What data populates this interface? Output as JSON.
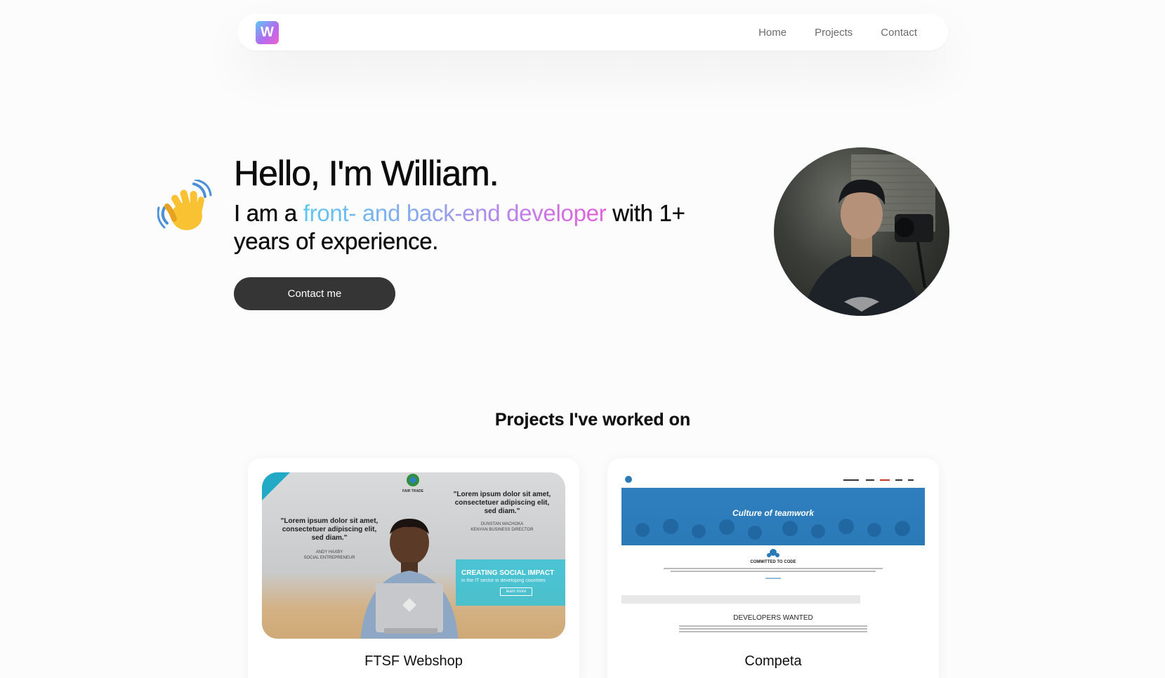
{
  "nav": {
    "logo_letter": "W",
    "links": [
      "Home",
      "Projects",
      "Contact"
    ]
  },
  "hero": {
    "title": "Hello, I'm William.",
    "sub_prefix": "I am a ",
    "sub_highlight": "front- and back-end developer",
    "sub_suffix": " with 1+ years of experience.",
    "button_label": "Contact me"
  },
  "projects": {
    "title": "Projects I've worked on",
    "items": [
      {
        "name": "FTSF Webshop",
        "thumb": {
          "logo_text": "FAIR TRADE",
          "quote_left": "\"Lorem ipsum dolor sit amet, consectetuer adipiscing elit, sed diam.\"",
          "attrib_left_name": "ANDY HAXBY",
          "attrib_left_role": "SOCIAL ENTREPRENEUR",
          "quote_right": "\"Lorem ipsum dolor sit amet, consectetuer adipiscing elit, sed diam.\"",
          "attrib_right_name": "DUNSTAN MACHOKA",
          "attrib_right_role": "KENYAN BUSINESS DIRECTOR",
          "impact_heading": "CREATING SOCIAL IMPACT",
          "impact_sub": "in the IT sector in developing countries",
          "impact_button": "learn more"
        }
      },
      {
        "name": "Competa",
        "thumb": {
          "banner_text": "Culture of teamwork",
          "committed": "COMMITTED TO CODE",
          "developers": "DEVELOPERS WANTED"
        }
      }
    ]
  },
  "colors": {
    "accent_gradient": [
      "#5cc7f2",
      "#c57ae8",
      "#e160d9"
    ],
    "button_bg": "#353535"
  },
  "icons": [
    "waving-hand-icon",
    "logo-icon"
  ]
}
